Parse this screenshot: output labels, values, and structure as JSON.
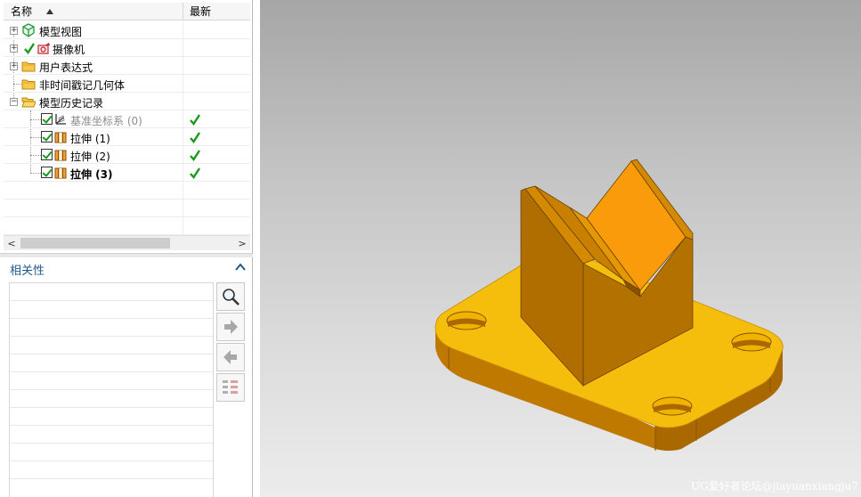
{
  "navigator": {
    "columns": {
      "name": "名称",
      "latest": "最新"
    },
    "nodes": [
      {
        "label": "模型视图",
        "icon": "model-views-icon"
      },
      {
        "label": "摄像机",
        "icon": "camera-icon"
      },
      {
        "label": "用户表达式",
        "icon": "folder-icon"
      },
      {
        "label": "非时间戳记几何体",
        "icon": "folder-icon"
      },
      {
        "label": "模型历史记录",
        "icon": "folder-open-icon"
      },
      {
        "label": "基准坐标系 (0)",
        "icon": "datum-csys-icon",
        "latest": "✔"
      },
      {
        "label": "拉伸 (1)",
        "icon": "extrude-icon",
        "latest": "✔"
      },
      {
        "label": "拉伸 (2)",
        "icon": "extrude-icon",
        "latest": "✔"
      },
      {
        "label": "拉伸 (3)",
        "icon": "extrude-icon",
        "latest": "✔"
      }
    ]
  },
  "dependencies": {
    "title": "相关性",
    "tools": [
      "magnifier-icon",
      "arrow-right-icon",
      "arrow-left-icon",
      "list-tree-icon"
    ]
  },
  "viewport": {
    "watermark": "UG爱好者论坛@jiayuanxiangju7"
  },
  "colors": {
    "model_top": "#f6be0c",
    "model_side_dark": "#a96800",
    "model_side_mid": "#c07900",
    "model_face_bright": "#f99b0b",
    "accent_title": "#1e5b8c",
    "check_green": "#1a9a1a"
  }
}
